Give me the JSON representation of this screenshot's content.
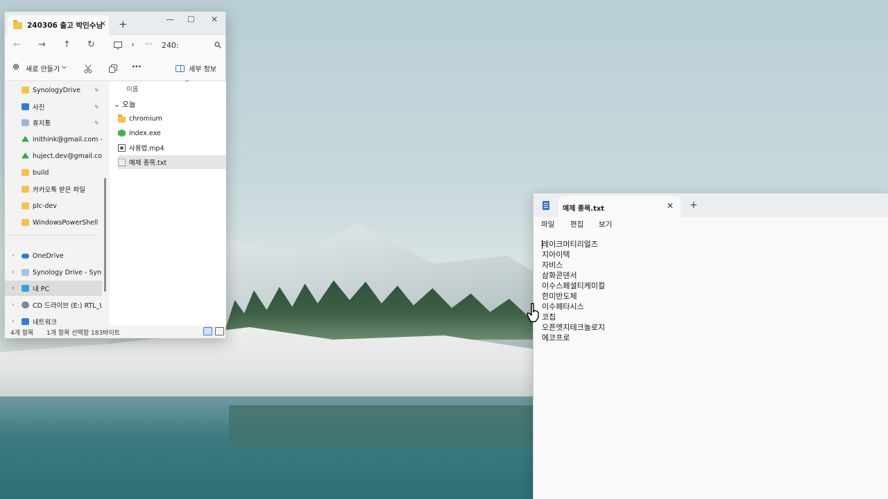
{
  "explorer": {
    "tab_title": "240306 출고 박인수님",
    "tab_close": "✕",
    "new_tab": "+",
    "window_controls": {
      "minimize": "—",
      "maximize": "☐",
      "close": "✕"
    },
    "nav": {
      "back": "←",
      "forward": "→",
      "up": "↑",
      "refresh": "↻",
      "more": "···",
      "path": "240:",
      "chevron": "›"
    },
    "toolbar": {
      "new_label": "새로 만들기",
      "new_icon": "⊕",
      "more": "···",
      "details_label": "세부 정보"
    },
    "sidebar": {
      "items": [
        {
          "label": "SynologyDrive",
          "icon": "synology-icon",
          "color": "#f2c24f",
          "pinned": true
        },
        {
          "label": "사진",
          "icon": "photos-icon",
          "color": "#2f7dd1",
          "pinned": true
        },
        {
          "label": "휴지통",
          "icon": "recycle-bin-icon",
          "color": "#9eb7d6",
          "pinned": true
        },
        {
          "label": "inithink@gmail.com - Google Drive",
          "icon": "google-drive-icon",
          "color": "#34a853",
          "pinned": true
        },
        {
          "label": "huject.dev@gmail.com - Google Drive",
          "icon": "google-drive-icon",
          "color": "#34a853",
          "pinned": true
        },
        {
          "label": "build",
          "icon": "folder-icon",
          "color": "#f2c24f",
          "pinned": false
        },
        {
          "label": "카카오톡 받은 파일",
          "icon": "folder-icon",
          "color": "#f2c24f",
          "pinned": false
        },
        {
          "label": "plc-dev",
          "icon": "folder-icon",
          "color": "#f2c24f",
          "pinned": false
        },
        {
          "label": "WindowsPowerShell",
          "icon": "folder-icon",
          "color": "#f2c24f",
          "pinned": false
        }
      ],
      "tree": [
        {
          "label": "OneDrive",
          "icon": "onedrive-icon",
          "color": "#2b7cd3",
          "selected": false
        },
        {
          "label": "Synology Drive - SynologyDrive",
          "icon": "synology-icon",
          "color": "#a9c3e0",
          "selected": false
        },
        {
          "label": "내 PC",
          "icon": "pc-icon",
          "color": "#3aa0d8",
          "selected": true
        },
        {
          "label": "CD 드라이브 (E:) RTL_UL",
          "icon": "cd-drive-icon",
          "color": "#7d8a96",
          "selected": false
        },
        {
          "label": "네트워크",
          "icon": "network-icon",
          "color": "#3a7bd5",
          "selected": false
        }
      ],
      "chevron": "›",
      "pin": "✎"
    },
    "content": {
      "column_name": "이름",
      "sort_indicator": "^",
      "group_label": "오늘",
      "group_chevron": "⌄",
      "files": [
        {
          "name": "chromium",
          "icon": "folder-icon",
          "color": "#f2c24f",
          "selected": false
        },
        {
          "name": "index.exe",
          "icon": "exe-icon",
          "color": "#4caf50",
          "selected": false
        },
        {
          "name": "사용법.mp4",
          "icon": "video-file-icon",
          "color": "#555555",
          "selected": false
        },
        {
          "name": "예제 종목.txt",
          "icon": "text-file-icon",
          "color": "#9aa4ad",
          "selected": true
        }
      ]
    },
    "status": {
      "count": "4개 항목",
      "selection": "1개 항목 선택함 183바이트"
    }
  },
  "notepad": {
    "tab_title": "예제 종목.txt",
    "tab_close": "✕",
    "new_tab": "+",
    "menu": {
      "file": "파일",
      "edit": "편집",
      "view": "보기"
    },
    "lines": [
      "레이크머티리얼즈",
      "지아이텍",
      "자비스",
      "삼화콘덴서",
      "이수스페셜티케미컬",
      "한미반도체",
      "이수페타시스",
      "코칩",
      "오픈엣지테크놀로지",
      "에코프로"
    ]
  }
}
